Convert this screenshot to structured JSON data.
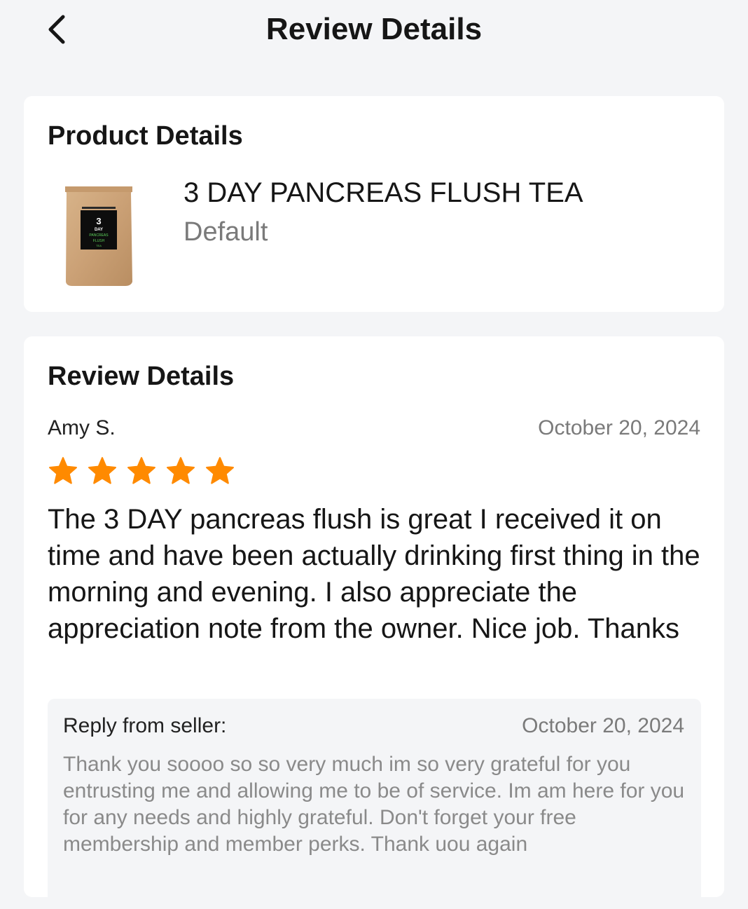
{
  "header": {
    "title": "Review Details",
    "back_icon": "chevron-left-icon"
  },
  "product_card": {
    "section_title": "Product Details",
    "product_name": "3 DAY PANCREAS FLUSH TEA",
    "variant": "Default",
    "image_label": {
      "line1": "3",
      "line2": "DAY",
      "line3": "PANCREAS",
      "line4": "FLUSH",
      "line5": "TEA"
    }
  },
  "review_card": {
    "section_title": "Review Details",
    "reviewer": "Amy S.",
    "date": "October 20, 2024",
    "rating": 5,
    "rating_max": 5,
    "star_color": "#ff8a00",
    "text": "The 3 DAY pancreas flush is great I received it on time and have been actually drinking first thing in the morning and evening. I also appreciate the appreciation note from the owner. Nice job. Thanks",
    "reply": {
      "label": "Reply from seller:",
      "date": "October 20, 2024",
      "text": "Thank you soooo so so very much im so very grateful  for you entrusting me and allowing me to be of service.  Im am here for you for any needs and highly grateful. Don't forget your free membership  and member perks. Thank uou again"
    }
  }
}
